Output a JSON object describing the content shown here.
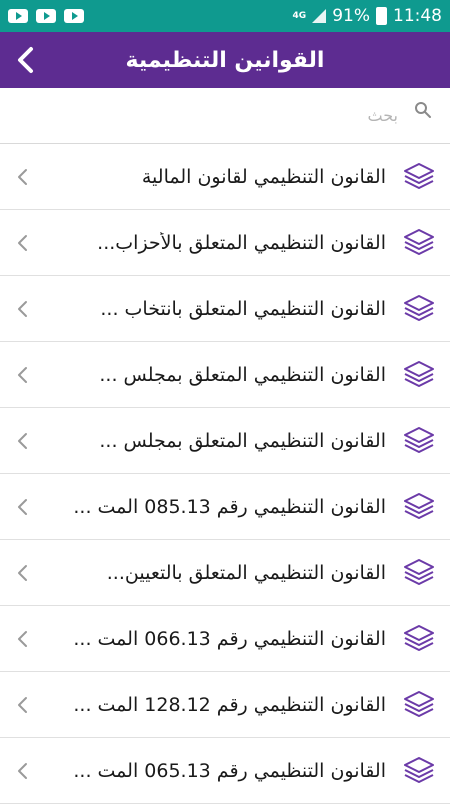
{
  "status_bar": {
    "network": "4G",
    "battery": "91%",
    "time": "11:48",
    "notification_icons": [
      "youtube-icon",
      "youtube-icon",
      "youtube-icon"
    ]
  },
  "appbar": {
    "title": "القوانين التنظيمية",
    "color": "#5d2c91"
  },
  "search": {
    "placeholder": "بحث",
    "value": ""
  },
  "items": [
    {
      "label": "القانون التنظيمي لقانون المالية"
    },
    {
      "label": "القانون التنظيمي المتعلق بالأحزاب..."
    },
    {
      "label": "القانون التنظيمي المتعلق بانتخاب ..."
    },
    {
      "label": "القانون التنظيمي المتعلق بمجلس ..."
    },
    {
      "label": "القانون التنظيمي المتعلق بمجلس ..."
    },
    {
      "label": "القانون التنظيمي رقم 085.13 المت ..."
    },
    {
      "label": "القانون التنظيمي المتعلق بالتعيين..."
    },
    {
      "label": "القانون التنظيمي رقم 066.13 المت ..."
    },
    {
      "label": "القانون التنظيمي رقم 128.12 المت ..."
    },
    {
      "label": "القانون التنظيمي رقم 065.13 المت ..."
    }
  ]
}
